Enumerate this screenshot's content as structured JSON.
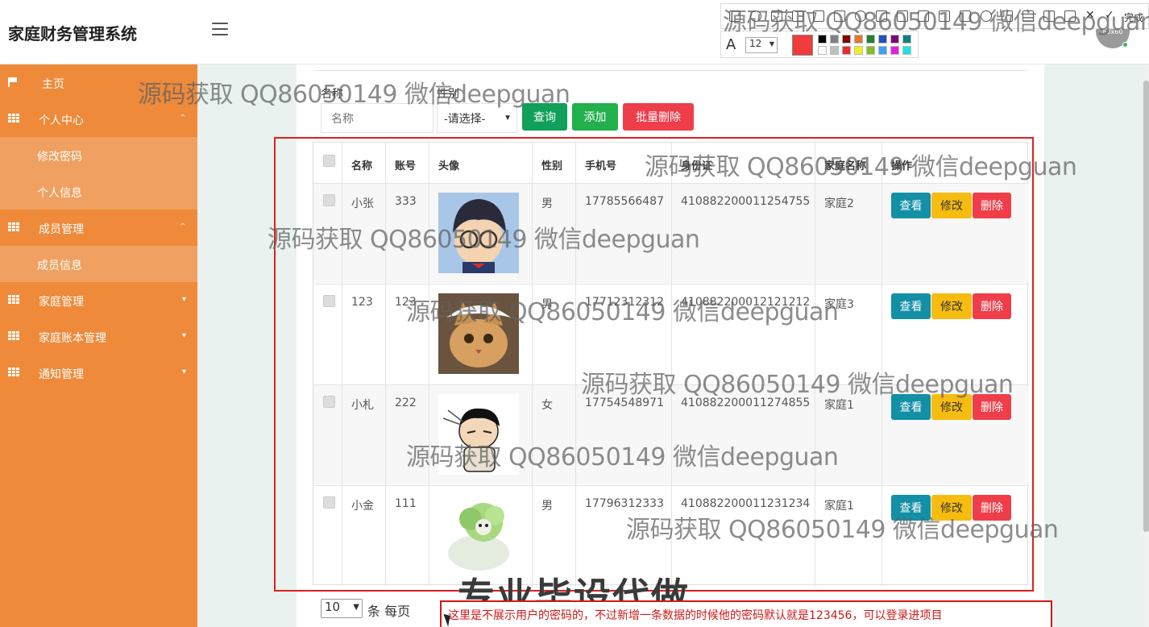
{
  "app": {
    "title": "家庭财务管理系统"
  },
  "avatar_text": "60x60",
  "sidebar": {
    "items": [
      {
        "label": "主页",
        "icon": "flag-icon"
      },
      {
        "label": "个人中心",
        "icon": "grid-icon",
        "caret": "⌃"
      },
      {
        "label": "修改密码"
      },
      {
        "label": "个人信息"
      },
      {
        "label": "成员管理",
        "icon": "grid-icon",
        "caret": "⌃"
      },
      {
        "label": "成员信息"
      },
      {
        "label": "家庭管理",
        "icon": "grid-icon",
        "caret": "▾"
      },
      {
        "label": "家庭账本管理",
        "icon": "grid-icon",
        "caret": "▾"
      },
      {
        "label": "通知管理",
        "icon": "grid-icon",
        "caret": "▾"
      }
    ]
  },
  "filter": {
    "name_label": "名称",
    "name_placeholder": "名称",
    "gender_label": "性别",
    "gender_value": "-请选择-",
    "query_label": "查询",
    "add_label": "添加",
    "batch_delete_label": "批量删除"
  },
  "table": {
    "headers": [
      "名称",
      "账号",
      "头像",
      "性别",
      "手机号",
      "身份证",
      "家庭名称",
      "操作"
    ],
    "rows": [
      {
        "name": "小张",
        "account": "333",
        "gender": "男",
        "phone": "17785566487",
        "id_card": "410882200011254755",
        "family": "家庭2"
      },
      {
        "name": "123",
        "account": "123",
        "gender": "男",
        "phone": "17712312312",
        "id_card": "410882200012121212",
        "family": "家庭3"
      },
      {
        "name": "小札",
        "account": "222",
        "gender": "女",
        "phone": "17754548971",
        "id_card": "410882200011274855",
        "family": "家庭1"
      },
      {
        "name": "小金",
        "account": "111",
        "gender": "男",
        "phone": "17796312333",
        "id_card": "410882200011231234",
        "family": "家庭1"
      }
    ],
    "view_label": "查看",
    "edit_label": "修改",
    "delete_label": "删除"
  },
  "pagination": {
    "page_size": "10",
    "per_page_text": "条 每页"
  },
  "overlay": {
    "watermark": "源码获取 QQ86050149 微信deepguan",
    "big_text": "专业毕设代做",
    "note": "这里是不展示用户的密码的，不过新增一条数据的时候他的密码默认就是123456，可以登录进项目",
    "toolbar_done": "完成",
    "font_size": "12"
  },
  "colors": {
    "sidebar": "#ee8a3a",
    "sidebar_sub": "#f0a060",
    "query": "#11a05a",
    "add": "#21b04c",
    "danger": "#ef3e4a",
    "view": "#138fa6",
    "edit": "#f6bc10",
    "annotation_red": "#e02020"
  }
}
